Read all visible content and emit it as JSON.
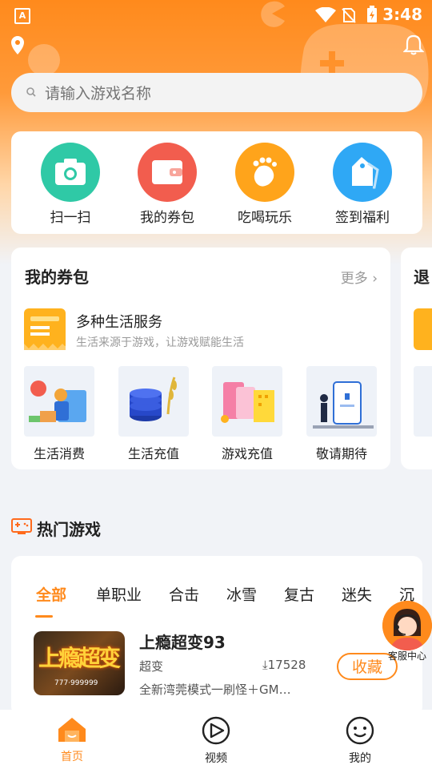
{
  "status_bar": {
    "time": "3:48",
    "app_icon_letter": "A"
  },
  "colors": {
    "accent": "#ff8a1c",
    "teal": "#2fc9a6",
    "red": "#f25d4e",
    "yellow": "#ffa41b",
    "blue": "#2fa8f5"
  },
  "search": {
    "placeholder": "请输入游戏名称"
  },
  "quick_actions": [
    {
      "label": "扫一扫",
      "icon": "camera-icon"
    },
    {
      "label": "我的券包",
      "icon": "wallet-icon"
    },
    {
      "label": "吃喝玩乐",
      "icon": "footprint-icon"
    },
    {
      "label": "签到福利",
      "icon": "tag-icon"
    }
  ],
  "wallet": {
    "title": "我的券包",
    "more": "更多",
    "next_card_title_partial": "退",
    "service_title": "多种生活服务",
    "service_subtitle": "生活来源于游戏，让游戏赋能生活",
    "tiles": [
      {
        "label": "生活消费"
      },
      {
        "label": "生活充值"
      },
      {
        "label": "游戏充值"
      },
      {
        "label": "敬请期待"
      }
    ]
  },
  "hot_games": {
    "title": "热门游戏",
    "tabs": [
      "全部",
      "单职业",
      "合击",
      "冰雪",
      "复古",
      "迷失",
      "沉"
    ],
    "active_tab": "全部",
    "game": {
      "name": "上瘾超变93",
      "cover_title": "上瘾超变",
      "cover_sub": "777·999999",
      "tag": "超变",
      "downloads": "17528",
      "description": "全新湾莞模式一刷怪＋GM…",
      "favorite_label": "收藏"
    }
  },
  "customer_service": {
    "label": "客服中心"
  },
  "bottom_nav": [
    {
      "label": "首页",
      "icon": "home-icon",
      "active": true
    },
    {
      "label": "视频",
      "icon": "play-icon",
      "active": false
    },
    {
      "label": "我的",
      "icon": "smile-icon",
      "active": false
    }
  ]
}
